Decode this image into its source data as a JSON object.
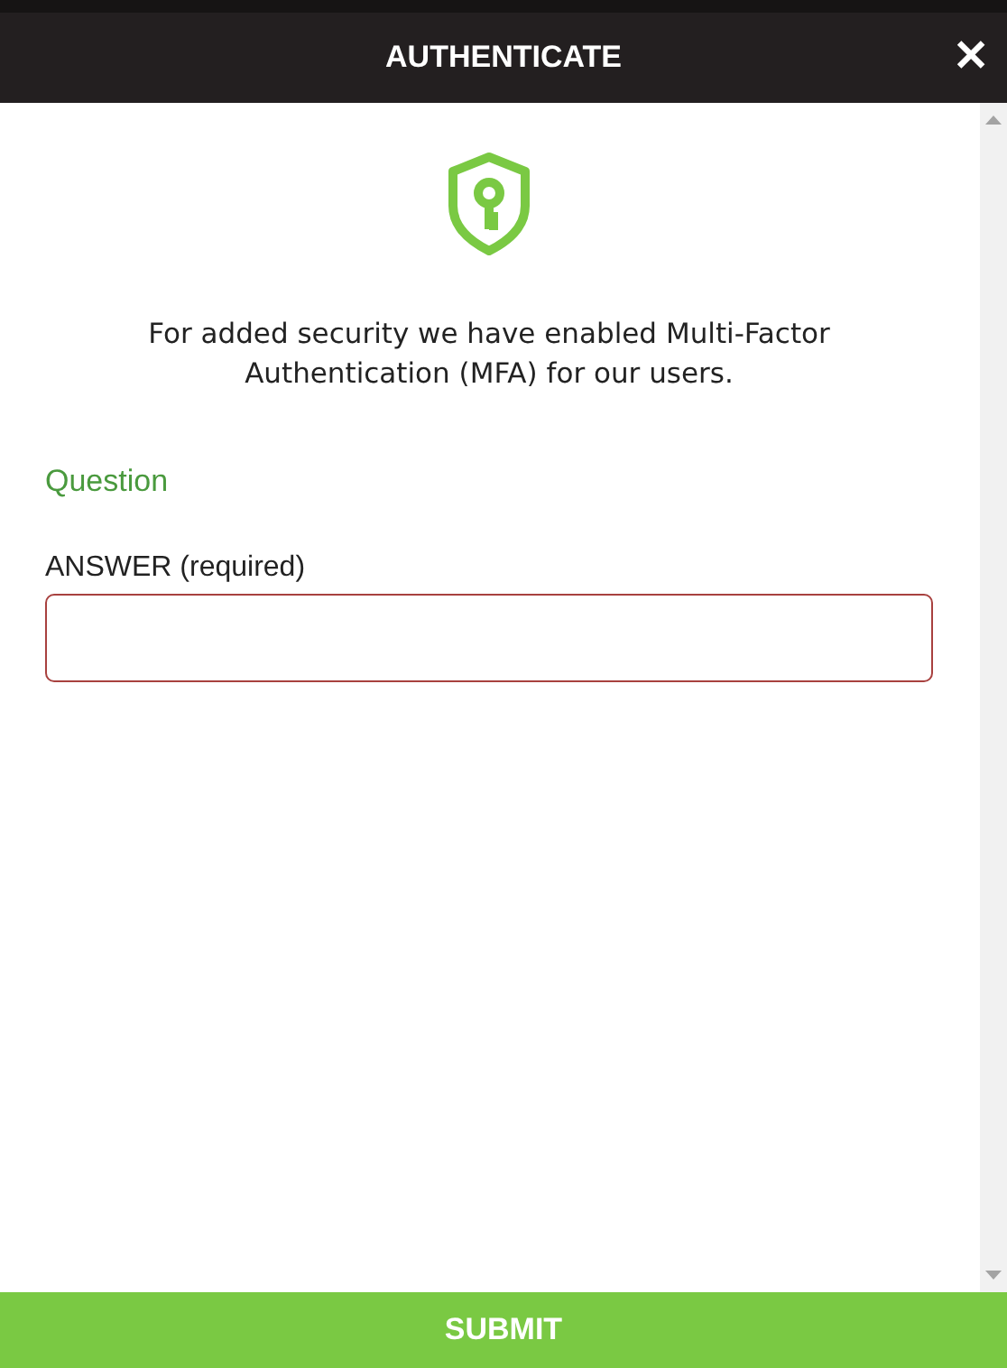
{
  "header": {
    "title": "AUTHENTICATE",
    "close": "✕"
  },
  "message": "For added security we have enabled Multi-Factor Authentication (MFA) for our users.",
  "question": "Question",
  "answer": {
    "label": "ANSWER (required)",
    "invalid": true
  },
  "submit": "SUBMIT"
}
